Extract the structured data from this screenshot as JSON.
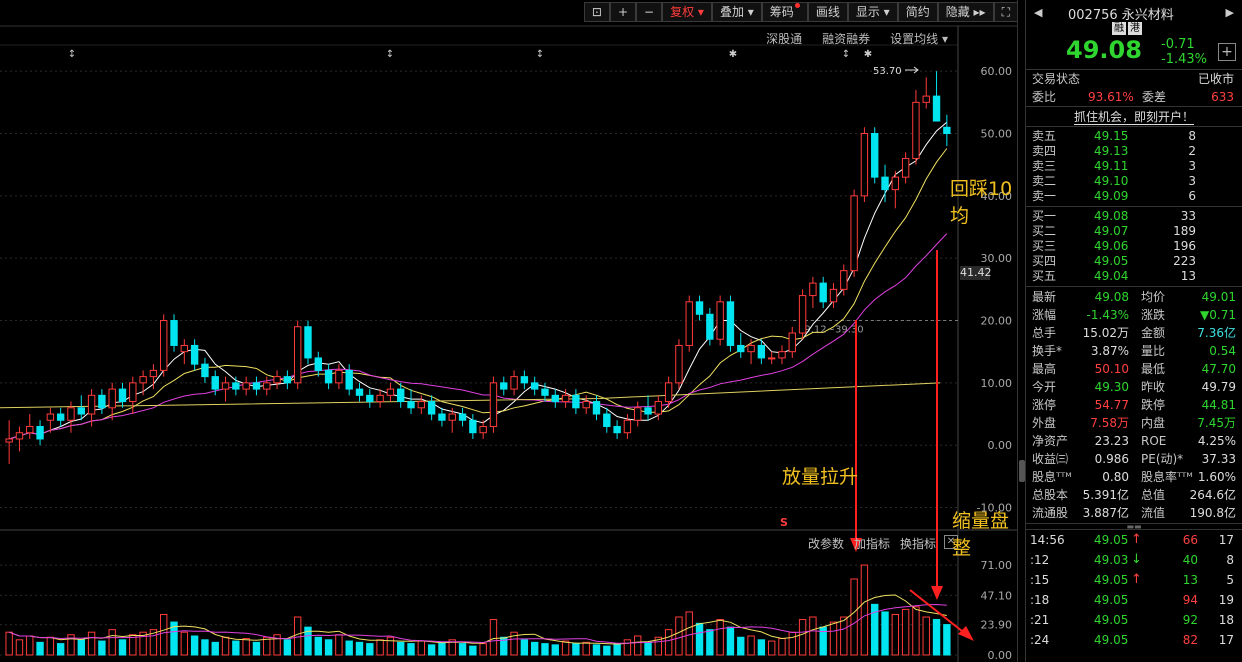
{
  "toolbar": {
    "items": [
      "复权",
      "叠加",
      "筹码",
      "画线",
      "显示",
      "简约",
      "隐藏"
    ],
    "tools": [
      "lock-icon",
      "crosshair-icon",
      "minus-icon"
    ]
  },
  "subtoolbar": {
    "items": [
      "深股通",
      "融资融券",
      "设置均线"
    ]
  },
  "chart": {
    "high_label": "53.70",
    "range_label": "39.12~39.30",
    "current_price_tag": "41.42",
    "y_labels": [
      "60.00",
      "50.00",
      "40.00",
      "30.00",
      "20.00",
      "10.00",
      "0.00",
      "-10.00"
    ],
    "vol_labels": [
      "71.00",
      "47.10",
      "23.90",
      "0.00"
    ],
    "indicator_tools": [
      "改参数",
      "加指标",
      "换指标"
    ],
    "s_marker": "S",
    "colors": {
      "up": "#ff3b3b",
      "down": "#00e5f0",
      "ma5": "#ffffff",
      "ma10": "#f0e060",
      "ma20": "#e040e0",
      "ma60": "#e0d060"
    }
  },
  "annotations": {
    "pullback": "回踩10均",
    "volume_rise": "放量拉升",
    "shrink": "缩量盘整"
  },
  "quote": {
    "code": "002756",
    "name": "永兴材料",
    "badges": [
      "融",
      "港"
    ],
    "price": "49.08",
    "change": "-0.71",
    "change_pct": "-1.43%",
    "status_label": "交易状态",
    "status": "已收市",
    "weibi_label": "委比",
    "weibi": "93.61%",
    "weicha_label": "委差",
    "weicha": "633",
    "promo": "抓住机会，即刻开户！"
  },
  "asks": [
    {
      "name": "卖五",
      "price": "49.15",
      "vol": "8"
    },
    {
      "name": "卖四",
      "price": "49.13",
      "vol": "2"
    },
    {
      "name": "卖三",
      "price": "49.11",
      "vol": "3"
    },
    {
      "name": "卖二",
      "price": "49.10",
      "vol": "3"
    },
    {
      "name": "卖一",
      "price": "49.09",
      "vol": "6"
    }
  ],
  "bids": [
    {
      "name": "买一",
      "price": "49.08",
      "vol": "33"
    },
    {
      "name": "买二",
      "price": "49.07",
      "vol": "189"
    },
    {
      "name": "买三",
      "price": "49.06",
      "vol": "196"
    },
    {
      "name": "买四",
      "price": "49.05",
      "vol": "223"
    },
    {
      "name": "买五",
      "price": "49.04",
      "vol": "13"
    }
  ],
  "stats": [
    {
      "l1": "最新",
      "v1": "49.08",
      "c1": "green",
      "l2": "均价",
      "v2": "49.01",
      "c2": "green"
    },
    {
      "l1": "涨幅",
      "v1": "-1.43%",
      "c1": "green",
      "l2": "涨跌",
      "v2": "▼0.71",
      "c2": "green"
    },
    {
      "l1": "总手",
      "v1": "15.02万",
      "c1": "white",
      "l2": "金额",
      "v2": "7.36亿",
      "c2": "cyan"
    },
    {
      "l1": "换手*",
      "v1": "3.87%",
      "c1": "white",
      "l2": "量比",
      "v2": "0.54",
      "c2": "green"
    },
    {
      "l1": "最高",
      "v1": "50.10",
      "c1": "red",
      "l2": "最低",
      "v2": "47.70",
      "c2": "green"
    },
    {
      "l1": "今开",
      "v1": "49.30",
      "c1": "green",
      "l2": "昨收",
      "v2": "49.79",
      "c2": "white"
    },
    {
      "l1": "涨停",
      "v1": "54.77",
      "c1": "red",
      "l2": "跌停",
      "v2": "44.81",
      "c2": "green"
    },
    {
      "l1": "外盘",
      "v1": "7.58万",
      "c1": "red",
      "l2": "内盘",
      "v2": "7.45万",
      "c2": "green"
    },
    {
      "l1": "净资产",
      "v1": "23.23",
      "c1": "white",
      "l2": "ROE",
      "v2": "4.25%",
      "c2": "white"
    },
    {
      "l1": "收益㈢",
      "v1": "0.986",
      "c1": "white",
      "l2": "PE(动)*",
      "v2": "37.33",
      "c2": "white"
    },
    {
      "l1": "股息ᵀᵀᴹ",
      "v1": "0.80",
      "c1": "white",
      "l2": "股息率ᵀᵀᴹ",
      "v2": "1.60%",
      "c2": "white"
    },
    {
      "l1": "总股本",
      "v1": "5.391亿",
      "c1": "white",
      "l2": "总值",
      "v2": "264.6亿",
      "c2": "white"
    },
    {
      "l1": "流通股",
      "v1": "3.887亿",
      "c1": "white",
      "l2": "流值",
      "v2": "190.8亿",
      "c2": "white"
    }
  ],
  "ticks": [
    {
      "time": "14:56",
      "price": "49.05",
      "dir": "up",
      "vol": "66",
      "vcol": "red",
      "n": "17"
    },
    {
      "time": ":12",
      "price": "49.03",
      "dir": "down",
      "vol": "40",
      "vcol": "green",
      "n": "8"
    },
    {
      "time": ":15",
      "price": "49.05",
      "dir": "up",
      "vol": "13",
      "vcol": "green",
      "n": "5"
    },
    {
      "time": ":18",
      "price": "49.05",
      "dir": "",
      "vol": "94",
      "vcol": "red",
      "n": "19"
    },
    {
      "time": ":21",
      "price": "49.05",
      "dir": "",
      "vol": "92",
      "vcol": "green",
      "n": "18"
    },
    {
      "time": ":24",
      "price": "49.05",
      "dir": "",
      "vol": "82",
      "vcol": "red",
      "n": "17"
    }
  ],
  "chart_data": {
    "type": "candlestick",
    "ylim": [
      -12,
      65
    ],
    "vol_ylim": [
      0,
      75
    ],
    "candles": [
      [
        0.5,
        4,
        -3,
        1
      ],
      [
        1,
        3,
        -1,
        2
      ],
      [
        2,
        5,
        1,
        3
      ],
      [
        3,
        4,
        0,
        1
      ],
      [
        4,
        6,
        2,
        5
      ],
      [
        5,
        6,
        3,
        4
      ],
      [
        4,
        7,
        2,
        6
      ],
      [
        6,
        8,
        4,
        5
      ],
      [
        5,
        9,
        3,
        8
      ],
      [
        8,
        9,
        5,
        6
      ],
      [
        6,
        10,
        4,
        9
      ],
      [
        9,
        10,
        6,
        7
      ],
      [
        7,
        11,
        5,
        10
      ],
      [
        10,
        12,
        8,
        11
      ],
      [
        11,
        13,
        9,
        12
      ],
      [
        12,
        21,
        11,
        20
      ],
      [
        20,
        21,
        15,
        16
      ],
      [
        15,
        17,
        13,
        16
      ],
      [
        16,
        17,
        12,
        13
      ],
      [
        13,
        14,
        10,
        11
      ],
      [
        11,
        12,
        8,
        9
      ],
      [
        9,
        11,
        7,
        10
      ],
      [
        10,
        11,
        8,
        9
      ],
      [
        9,
        11,
        8,
        10
      ],
      [
        10,
        11,
        8,
        9
      ],
      [
        9,
        11,
        8,
        10
      ],
      [
        10,
        12,
        9,
        11
      ],
      [
        11,
        12,
        9,
        10
      ],
      [
        10,
        20,
        9,
        19
      ],
      [
        19,
        20,
        13,
        14
      ],
      [
        14,
        15,
        11,
        12
      ],
      [
        12,
        13,
        9,
        10
      ],
      [
        10,
        13,
        9,
        12
      ],
      [
        12,
        13,
        8,
        9
      ],
      [
        9,
        10,
        7,
        8
      ],
      [
        8,
        9,
        6,
        7
      ],
      [
        7,
        9,
        6,
        8
      ],
      [
        8,
        10,
        7,
        9
      ],
      [
        9,
        10,
        6,
        7
      ],
      [
        7,
        9,
        5,
        6
      ],
      [
        6,
        8,
        5,
        7
      ],
      [
        7,
        8,
        4,
        5
      ],
      [
        5,
        6,
        3,
        4
      ],
      [
        4,
        6,
        2,
        5
      ],
      [
        5,
        6,
        3,
        4
      ],
      [
        4,
        5,
        1,
        2
      ],
      [
        2,
        4,
        1,
        3
      ],
      [
        3,
        11,
        2,
        10
      ],
      [
        10,
        11,
        8,
        9
      ],
      [
        9,
        12,
        8,
        11
      ],
      [
        11,
        12,
        9,
        10
      ],
      [
        10,
        11,
        8,
        9
      ],
      [
        9,
        10,
        7,
        8
      ],
      [
        8,
        9,
        6,
        7
      ],
      [
        7,
        9,
        6,
        8
      ],
      [
        8,
        9,
        5,
        6
      ],
      [
        6,
        8,
        5,
        7
      ],
      [
        7,
        8,
        4,
        5
      ],
      [
        5,
        6,
        2,
        3
      ],
      [
        3,
        4,
        1,
        2
      ],
      [
        2,
        5,
        1,
        4
      ],
      [
        4,
        7,
        3,
        6
      ],
      [
        6,
        8,
        4,
        5
      ],
      [
        5,
        8,
        4,
        7
      ],
      [
        7,
        11,
        6,
        10
      ],
      [
        10,
        17,
        9,
        16
      ],
      [
        16,
        24,
        15,
        23
      ],
      [
        23,
        24,
        20,
        21
      ],
      [
        21,
        22,
        16,
        17
      ],
      [
        17,
        24,
        16,
        23
      ],
      [
        23,
        24,
        15,
        16
      ],
      [
        16,
        18,
        14,
        15
      ],
      [
        15,
        17,
        13,
        16
      ],
      [
        16,
        17,
        13,
        14
      ],
      [
        14,
        15,
        13,
        14
      ],
      [
        14,
        16,
        13,
        15
      ],
      [
        15,
        19,
        14,
        18
      ],
      [
        18,
        25,
        17,
        24
      ],
      [
        24,
        27,
        22,
        26
      ],
      [
        26,
        27,
        22,
        23
      ],
      [
        23,
        26,
        22,
        25
      ],
      [
        25,
        29,
        24,
        28
      ],
      [
        28,
        41,
        27,
        40
      ],
      [
        40,
        51,
        39,
        50
      ],
      [
        50,
        51,
        42,
        43
      ],
      [
        43,
        45,
        39,
        41
      ],
      [
        41,
        44,
        38,
        43
      ],
      [
        43,
        47,
        42,
        46
      ],
      [
        46,
        57,
        45,
        55
      ],
      [
        55,
        59,
        54,
        56
      ],
      [
        56,
        60,
        52,
        52
      ],
      [
        51,
        53,
        48,
        50
      ]
    ],
    "volumes": [
      18,
      12,
      15,
      10,
      14,
      9,
      16,
      12,
      18,
      11,
      20,
      12,
      16,
      18,
      20,
      32,
      26,
      18,
      15,
      12,
      10,
      14,
      11,
      13,
      10,
      14,
      16,
      12,
      30,
      22,
      14,
      12,
      16,
      11,
      10,
      9,
      12,
      14,
      10,
      9,
      11,
      8,
      10,
      12,
      9,
      7,
      9,
      28,
      14,
      18,
      12,
      10,
      9,
      8,
      11,
      9,
      10,
      8,
      7,
      9,
      12,
      15,
      10,
      14,
      20,
      30,
      34,
      25,
      20,
      28,
      22,
      14,
      15,
      12,
      11,
      13,
      18,
      28,
      30,
      22,
      26,
      30,
      60,
      71,
      40,
      34,
      32,
      36,
      38,
      30,
      28,
      24
    ]
  }
}
